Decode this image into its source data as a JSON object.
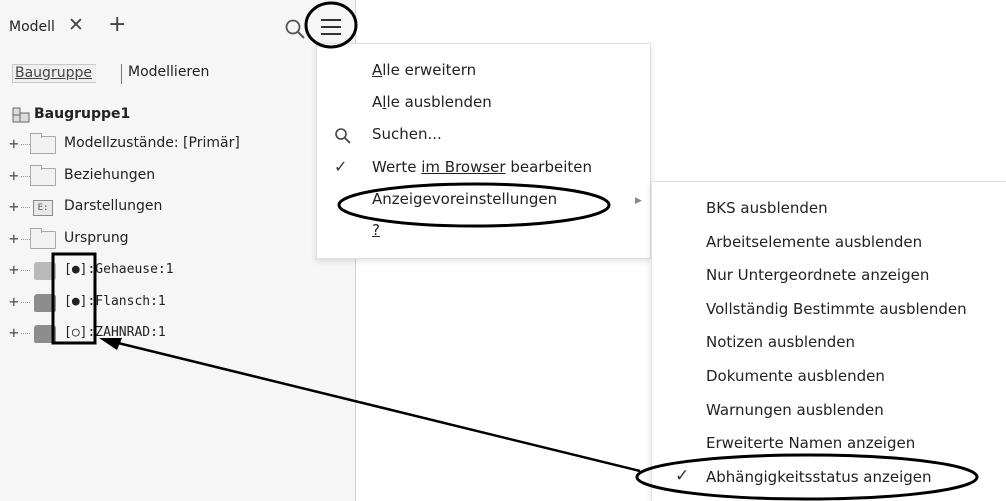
{
  "panel": {
    "tab_label": "Modell",
    "tab_close": "✕",
    "tab_add": "+",
    "subtab_assembly": "Baugruppe",
    "subtab_modeling": "Modellieren"
  },
  "tree": {
    "root": "Baugruppe1",
    "nodes": [
      {
        "label": "Modellzustände: [Primär]",
        "icon": "folder-icon"
      },
      {
        "label": "Beziehungen",
        "icon": "folder-icon"
      },
      {
        "label": "Darstellungen",
        "icon": "representations-icon"
      },
      {
        "label": "Ursprung",
        "icon": "folder-icon"
      },
      {
        "label": "[●]:Gehaeuse:1",
        "icon": "part-icon"
      },
      {
        "label": "[●]:Flansch:1",
        "icon": "part-icon"
      },
      {
        "label": "[○]:ZAHNRAD:1",
        "icon": "part-icon"
      }
    ]
  },
  "menu": {
    "expand_all_u": "A",
    "expand_all_rest": "lle erweitern",
    "collapse_all_pre": "A",
    "collapse_all_u": "l",
    "collapse_all_rest": "le ausblenden",
    "search": "Suchen...",
    "edit_values_pre": "Werte ",
    "edit_values_u": "im Browser",
    "edit_values_rest": " bearbeiten",
    "display_prefs": "Anzeigevoreinstellungen",
    "help": "?"
  },
  "submenu": {
    "items": [
      "BKS ausblenden",
      "Arbeitselemente ausblenden",
      "Nur Untergeordnete anzeigen",
      "Vollständig Bestimmte ausblenden",
      "Notizen ausblenden",
      "Dokumente ausblenden",
      "Warnungen ausblenden",
      "Erweiterte Namen anzeigen",
      "Abhängigkeitsstatus anzeigen"
    ],
    "check": "✓"
  },
  "icons": {
    "search": "search-icon",
    "menu": "hamburger-menu-icon",
    "check": "checkmark-icon",
    "submenu_arrow": "chevron-right-icon"
  },
  "colors": {
    "panel_bg": "#f6f6f6",
    "annotation": "#000000"
  }
}
